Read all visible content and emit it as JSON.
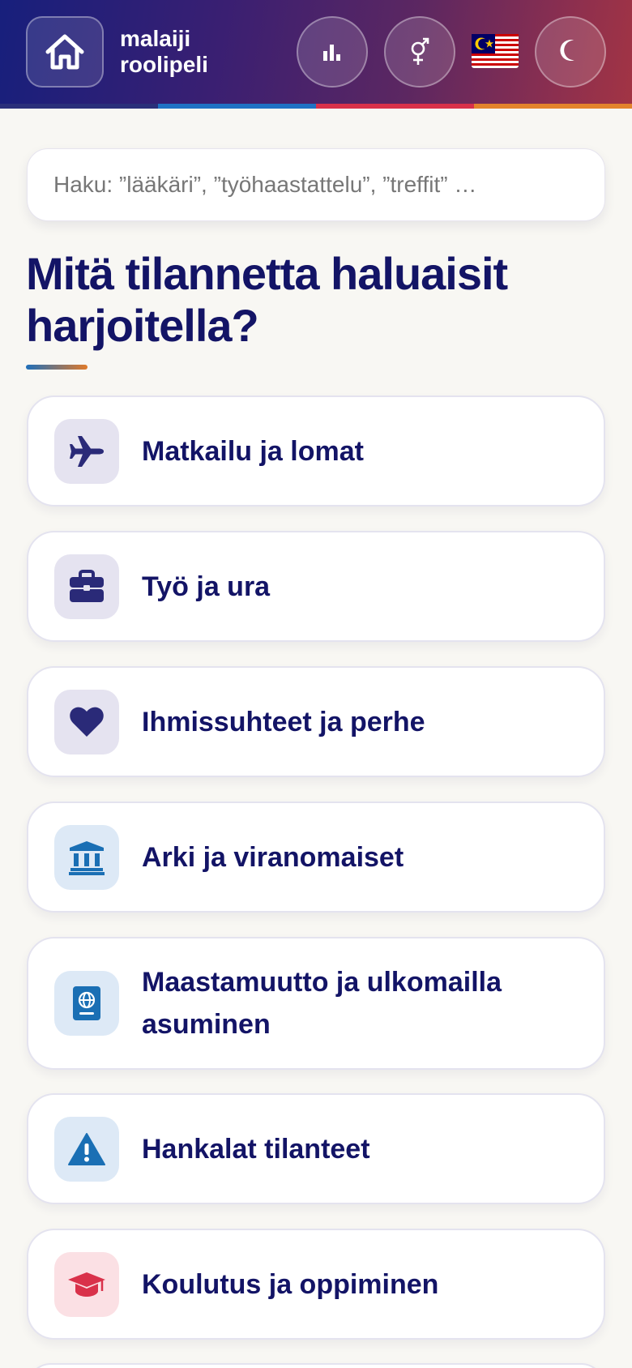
{
  "app": {
    "brand_line1": "malaiji",
    "brand_line2": "roolipeli"
  },
  "header": {
    "home_icon": "home-icon",
    "stats_icon": "bar-chart-icon",
    "gender_icon": "gender-icon",
    "flag_icon": "malaysia-flag-icon",
    "theme_icon": "moon-icon",
    "stripe_colors": [
      "#2a2f7a",
      "#1f72c4",
      "#d9314a",
      "#e3832c"
    ]
  },
  "search": {
    "placeholder": "Haku: ”lääkäri”, ”työhaastattelu”, ”treffit” …",
    "value": ""
  },
  "main": {
    "title": "Mitä tilannetta haluaisit harjoitella?",
    "categories": [
      {
        "label": "Matkailu ja lomat",
        "icon": "plane-icon",
        "tint": "#e5e3f0",
        "color": "#2a2a78"
      },
      {
        "label": "Työ ja ura",
        "icon": "briefcase-icon",
        "tint": "#e5e3f0",
        "color": "#2a2a78"
      },
      {
        "label": "Ihmissuhteet ja perhe",
        "icon": "heart-icon",
        "tint": "#e5e3f0",
        "color": "#2a2a78"
      },
      {
        "label": "Arki ja viranomaiset",
        "icon": "institution-icon",
        "tint": "#dde9f6",
        "color": "#1a6fb4"
      },
      {
        "label": "Maastamuutto ja ulkomailla asuminen",
        "icon": "passport-icon",
        "tint": "#dde9f6",
        "color": "#1a6fb4"
      },
      {
        "label": "Hankalat tilanteet",
        "icon": "warning-icon",
        "tint": "#dde9f6",
        "color": "#1a6fb4"
      },
      {
        "label": "Koulutus ja oppiminen",
        "icon": "graduation-cap-icon",
        "tint": "#fbe0e4",
        "color": "#d9314a"
      }
    ]
  }
}
